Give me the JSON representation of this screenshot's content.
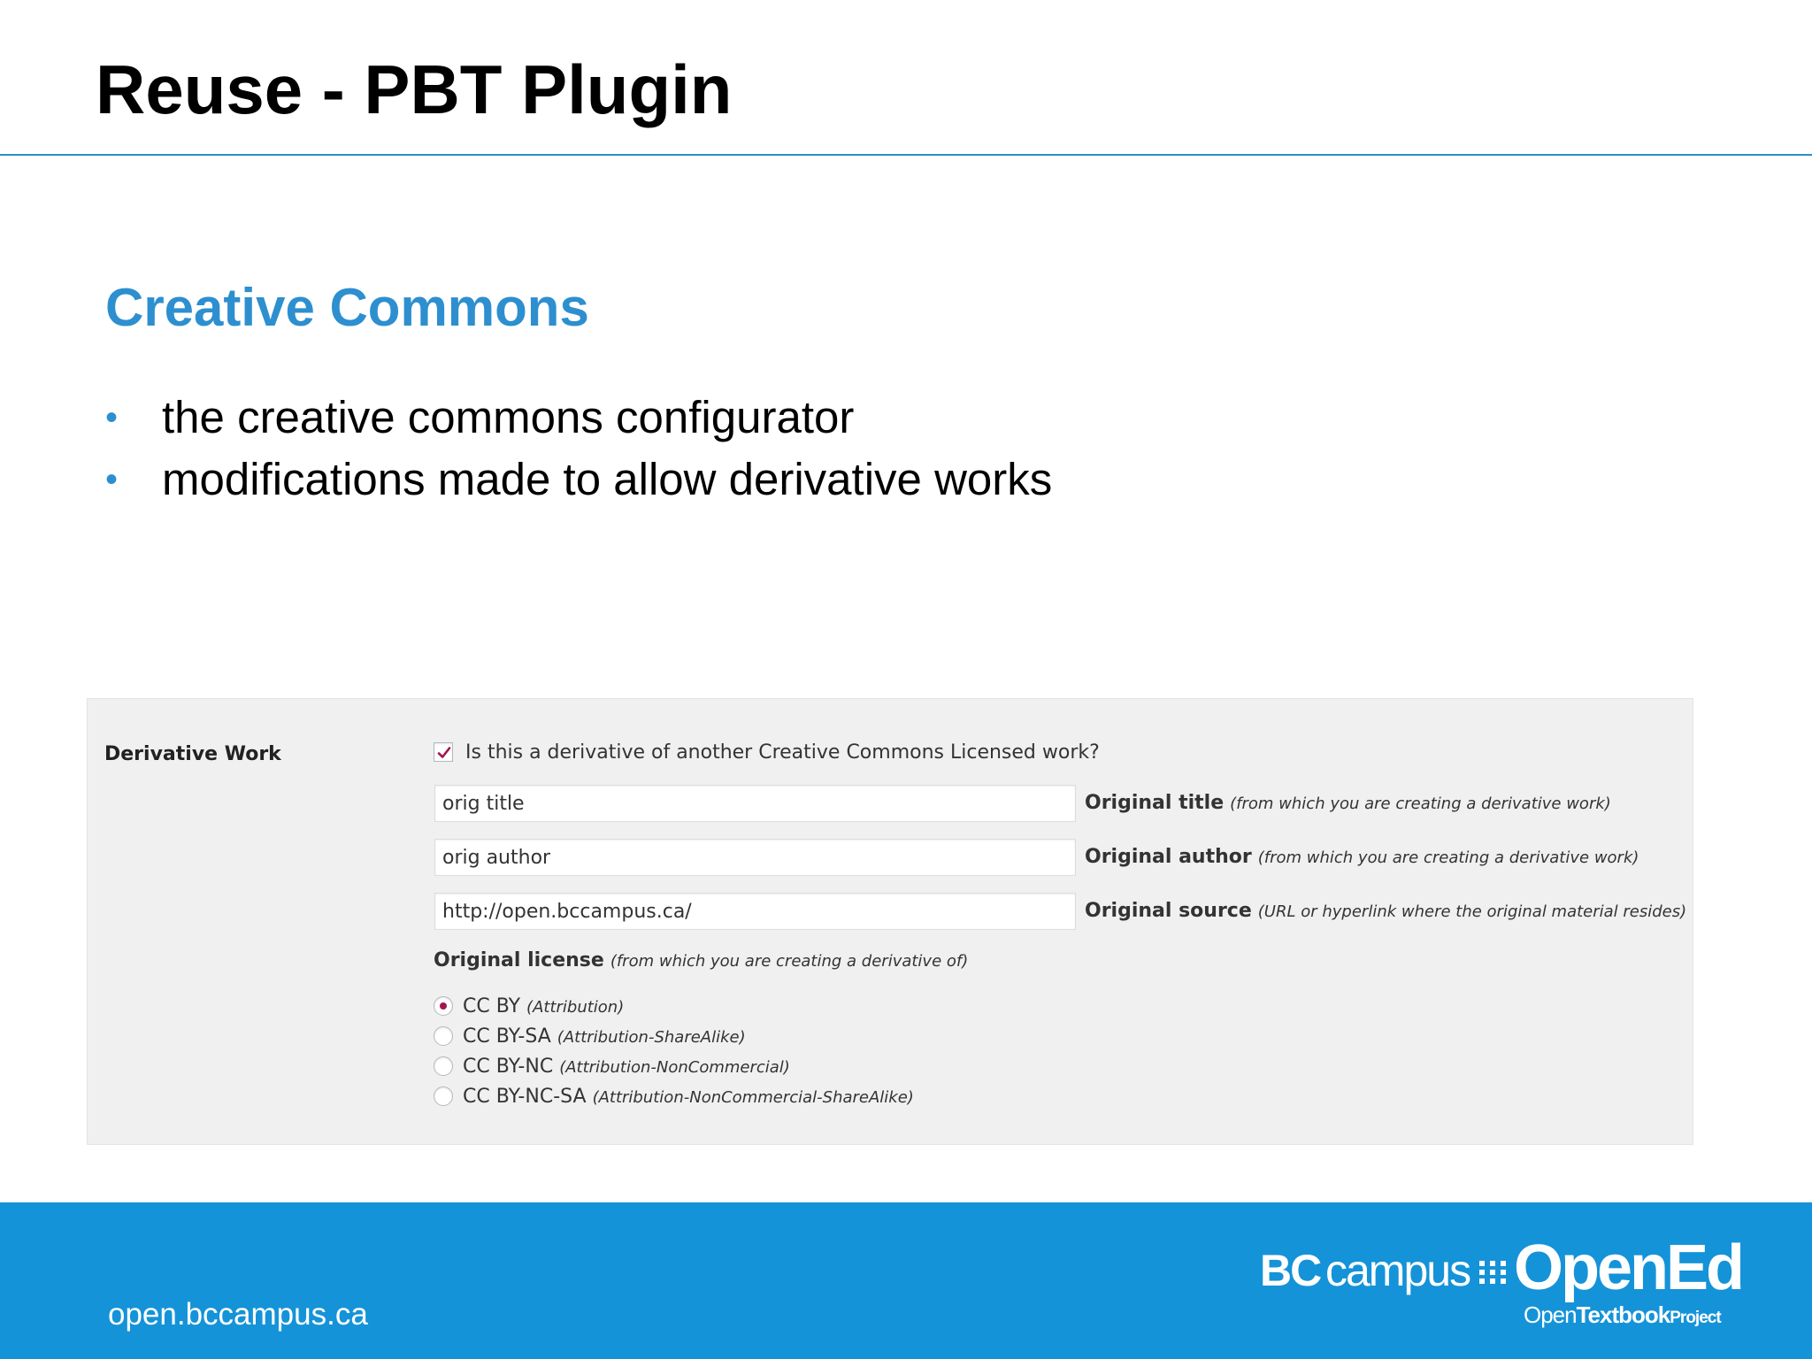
{
  "slide": {
    "title": "Reuse - PBT Plugin",
    "section_heading": "Creative Commons",
    "bullets": [
      "the creative commons configurator",
      "modifications made to allow derivative works"
    ]
  },
  "form": {
    "row_label": "Derivative Work",
    "derivative_checkbox": {
      "label": "Is this a derivative of another Creative Commons Licensed work?",
      "checked": true
    },
    "fields": [
      {
        "value": "orig title",
        "label": "Original title",
        "hint": "(from which you are creating a derivative work)"
      },
      {
        "value": "orig author",
        "label": "Original author",
        "hint": "(from which you are creating a derivative work)"
      },
      {
        "value": "http://open.bccampus.ca/",
        "label": "Original source",
        "hint": "(URL or hyperlink where the original material resides)"
      }
    ],
    "license": {
      "label": "Original license",
      "hint": "(from which you are creating a derivative of)",
      "options": [
        {
          "code": "CC BY",
          "name": "(Attribution)",
          "selected": true
        },
        {
          "code": "CC BY-SA",
          "name": "(Attribution-ShareAlike)",
          "selected": false
        },
        {
          "code": "CC BY-NC",
          "name": "(Attribution-NonCommercial)",
          "selected": false
        },
        {
          "code": "CC BY-NC-SA",
          "name": "(Attribution-NonCommercial-ShareAlike)",
          "selected": false
        }
      ]
    }
  },
  "footer": {
    "url": "open.bccampus.ca",
    "logo": {
      "bc": "BC",
      "campus": "campus",
      "opened": "OpenEd",
      "sub_open": "Open",
      "sub_textbook": "Textbook",
      "sub_project": "Project"
    }
  },
  "colors": {
    "accent_blue": "#2d8fcf",
    "footer_blue": "#1593d8",
    "panel_bg": "#f0f0f1",
    "check_color": "#a3154f"
  },
  "icons": {
    "checkbox_mark": "checkmark-icon",
    "bullet": "bullet-dot-icon",
    "logo_dots": "grid-dots-icon"
  }
}
